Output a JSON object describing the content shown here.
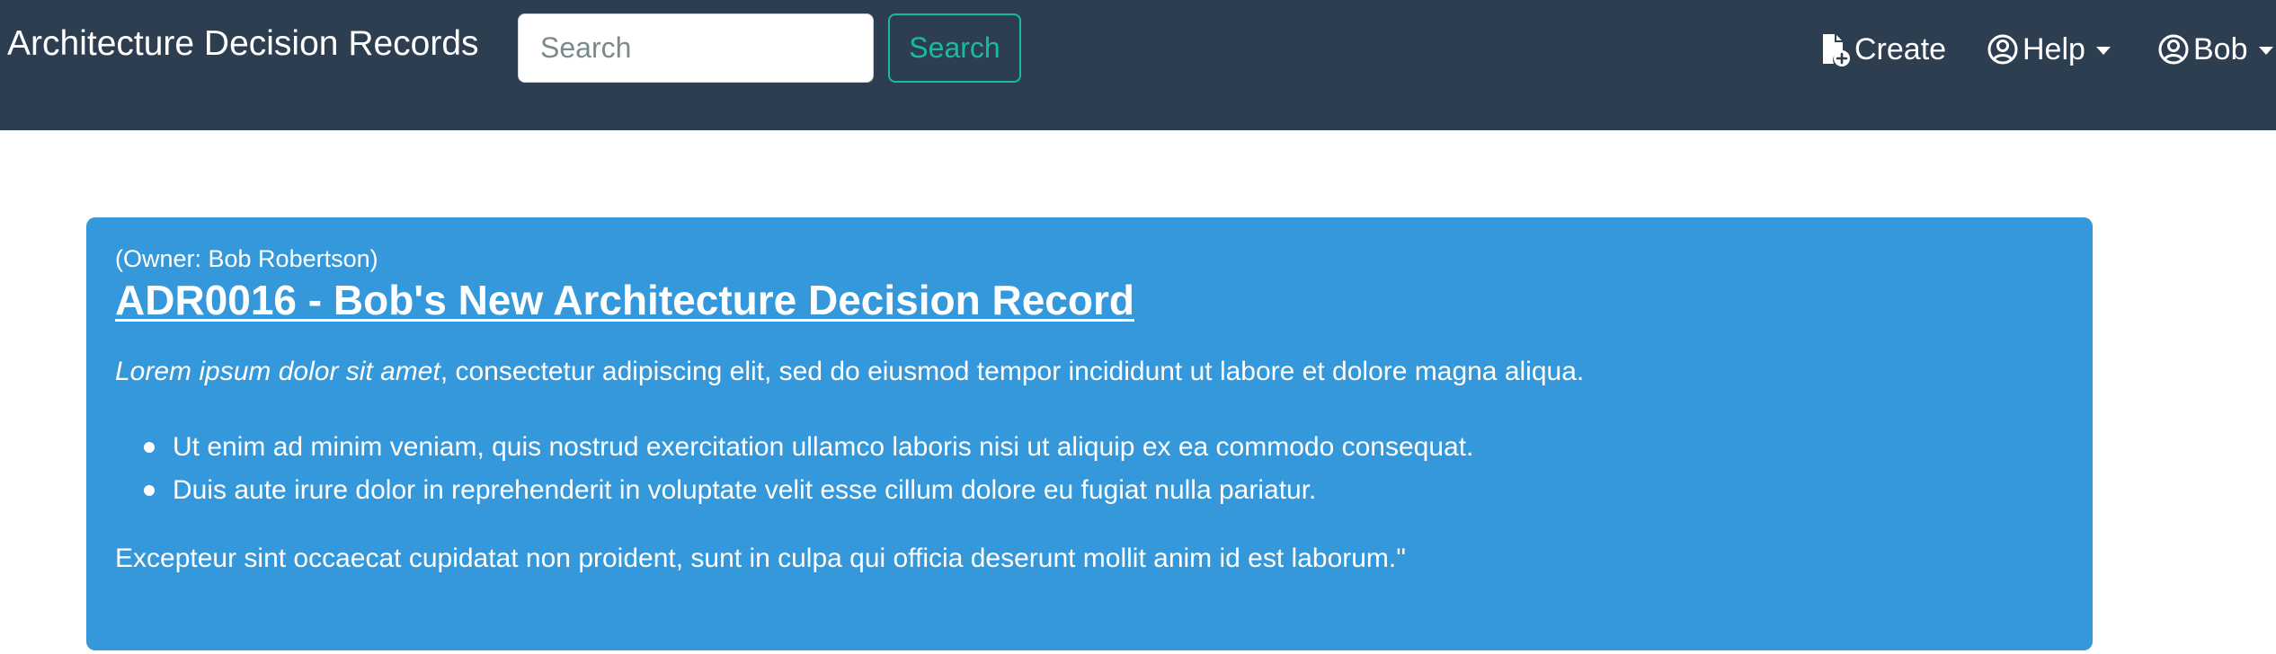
{
  "navbar": {
    "brand": "Architecture Decision Records",
    "search_placeholder": "Search",
    "search_button": "Search",
    "create_label": "Create",
    "help_label": "Help",
    "user_label": "Bob",
    "background_color": "#2c3e50",
    "accent_color": "#18bc9c"
  },
  "adr": {
    "owner": "(Owner: Bob Robertson)",
    "title": "ADR0016 - Bob's New Architecture Decision Record",
    "intro_emphasis": "Lorem ipsum dolor sit amet",
    "intro_rest": ", consectetur adipiscing elit, sed do eiusmod tempor incididunt ut labore et dolore magna aliqua.",
    "bullets": [
      "Ut enim ad minim veniam, quis nostrud exercitation ullamco laboris nisi ut aliquip ex ea commodo consequat.",
      "Duis aute irure dolor in reprehenderit in voluptate velit esse cillum dolore eu fugiat nulla pariatur."
    ],
    "closing": "Excepteur sint occaecat cupidatat non proident, sunt in culpa qui officia deserunt mollit anim id est laborum.\"",
    "card_color": "#3498db"
  }
}
